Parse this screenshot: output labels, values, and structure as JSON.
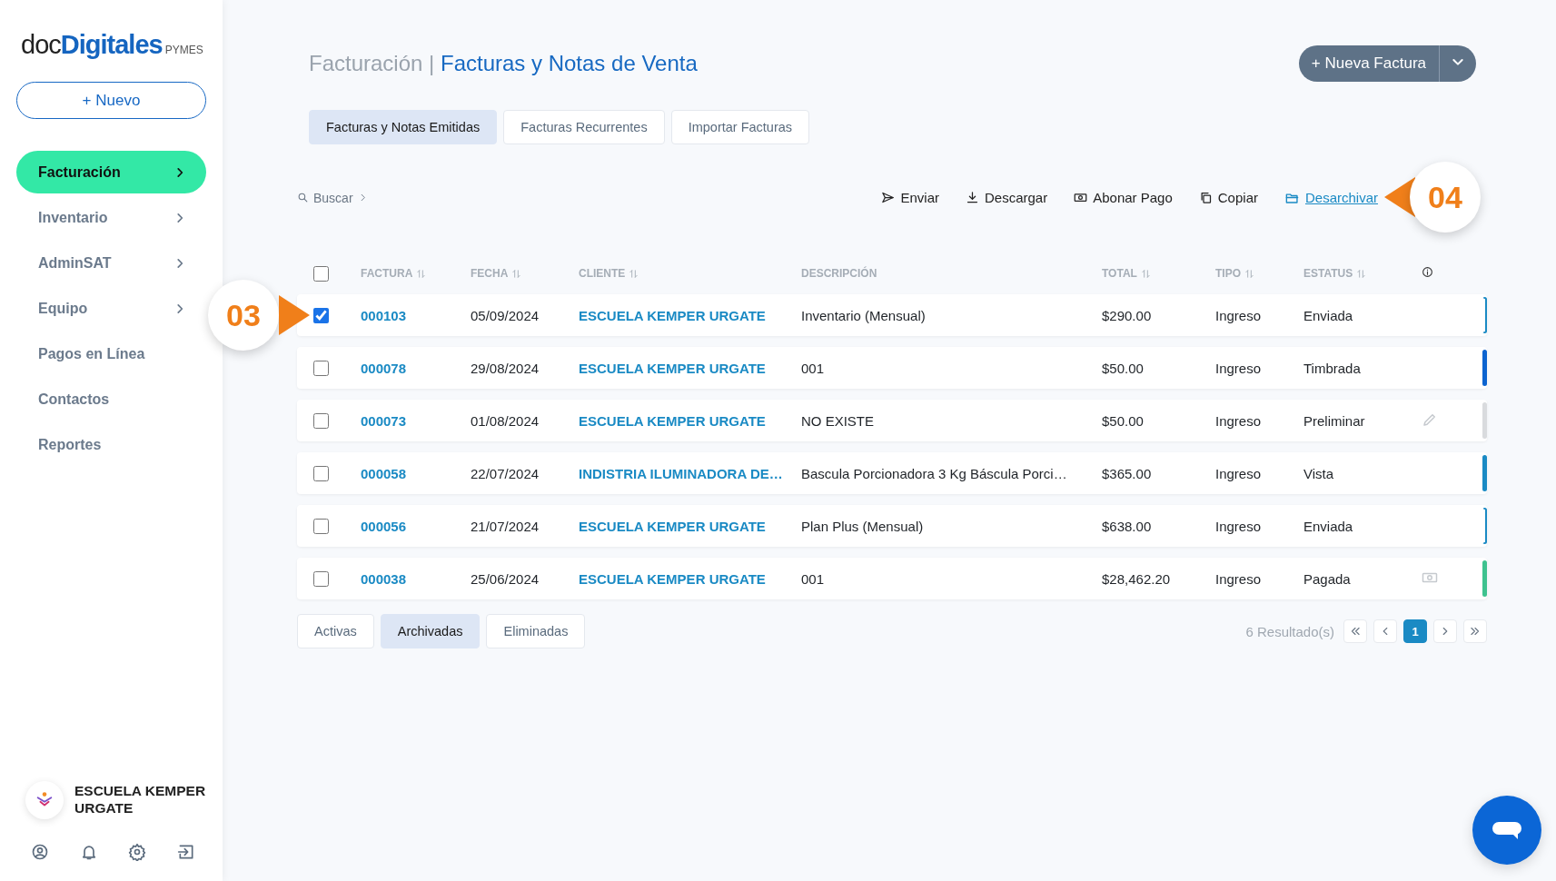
{
  "sidebar": {
    "logo": {
      "prefix": "doc",
      "brand": "Digitales",
      "suffix": "PYMES"
    },
    "new_button": {
      "icon": "+",
      "label": "Nuevo"
    },
    "items": [
      {
        "label": "Facturación",
        "selected": true,
        "has_submenu": true
      },
      {
        "label": "Inventario",
        "selected": false,
        "has_submenu": true
      },
      {
        "label": "AdminSAT",
        "selected": false,
        "has_submenu": true
      },
      {
        "label": "Equipo",
        "selected": false,
        "has_submenu": true
      },
      {
        "label": "Pagos en Línea",
        "selected": false,
        "has_submenu": false
      },
      {
        "label": "Contactos",
        "selected": false,
        "has_submenu": false
      },
      {
        "label": "Reportes",
        "selected": false,
        "has_submenu": false
      }
    ],
    "account": {
      "name": "ESCUELA KEMPER URGATE"
    },
    "footer_icons": [
      {
        "kind": "profile"
      },
      {
        "kind": "notifications"
      },
      {
        "kind": "settings"
      },
      {
        "kind": "logout"
      }
    ]
  },
  "header": {
    "breadcrumb": "Facturación",
    "separator": "|",
    "title": "Facturas y Notas de Venta",
    "primary_button": {
      "icon": "+",
      "label": "Nueva Factura"
    }
  },
  "tabs": [
    {
      "label": "Facturas y Notas Emitidas",
      "selected": true
    },
    {
      "label": "Facturas Recurrentes",
      "selected": false
    },
    {
      "label": "Importar Facturas",
      "selected": false
    }
  ],
  "toolbar": {
    "search": "Buscar",
    "actions": [
      {
        "kind": "send",
        "label": "Enviar",
        "link": false
      },
      {
        "kind": "download",
        "label": "Descargar",
        "link": false
      },
      {
        "kind": "payment",
        "label": "Abonar Pago",
        "link": false
      },
      {
        "kind": "copy",
        "label": "Copiar",
        "link": false
      },
      {
        "kind": "unarchive",
        "label": "Desarchivar",
        "link": true
      }
    ]
  },
  "table": {
    "select_all": {
      "checked": false
    },
    "columns": [
      {
        "label": "FACTURA",
        "sortable": true
      },
      {
        "label": "FECHA",
        "sortable": true
      },
      {
        "label": "CLIENTE",
        "sortable": true
      },
      {
        "label": "DESCRIPCIÓN",
        "sortable": false
      },
      {
        "label": "TOTAL",
        "sortable": true
      },
      {
        "label": "TIPO",
        "sortable": true
      },
      {
        "label": "ESTATUS",
        "sortable": true
      }
    ],
    "rows": [
      {
        "checked": true,
        "factura": "000103",
        "fecha": "05/09/2024",
        "cliente": "ESCUELA KEMPER URGATE",
        "descripcion": "Inventario (Mensual)",
        "total": "$290.00",
        "tipo": "Ingreso",
        "estatus": "Enviada",
        "status_marker": {
          "kind": "outline",
          "color": "#1a8ac4"
        }
      },
      {
        "checked": false,
        "factura": "000078",
        "fecha": "29/08/2024",
        "cliente": "ESCUELA KEMPER URGATE",
        "descripcion": "001",
        "total": "$50.00",
        "tipo": "Ingreso",
        "estatus": "Timbrada",
        "status_marker": {
          "kind": "solid",
          "color": "#0b63d0"
        }
      },
      {
        "checked": false,
        "factura": "000073",
        "fecha": "01/08/2024",
        "cliente": "ESCUELA KEMPER URGATE",
        "descripcion": "NO EXISTE",
        "total": "$50.00",
        "tipo": "Ingreso",
        "estatus": "Preliminar",
        "status_marker": {
          "kind": "solid",
          "color": "#d9dbde"
        },
        "action_icon": {
          "kind": "edit"
        }
      },
      {
        "checked": false,
        "factura": "000058",
        "fecha": "22/07/2024",
        "cliente": "INDISTRIA ILUMINADORA DE…",
        "descripcion": "Bascula Porcionadora 3 Kg Báscula Porci…",
        "total": "$365.00",
        "tipo": "Ingreso",
        "estatus": "Vista",
        "status_marker": {
          "kind": "solid",
          "color": "#1a8ac4"
        }
      },
      {
        "checked": false,
        "factura": "000056",
        "fecha": "21/07/2024",
        "cliente": "ESCUELA KEMPER URGATE",
        "descripcion": "Plan Plus (Mensual)",
        "total": "$638.00",
        "tipo": "Ingreso",
        "estatus": "Enviada",
        "status_marker": {
          "kind": "outline",
          "color": "#1a8ac4"
        }
      },
      {
        "checked": false,
        "factura": "000038",
        "fecha": "25/06/2024",
        "cliente": "ESCUELA KEMPER URGATE",
        "descripcion": "001",
        "total": "$28,462.20",
        "tipo": "Ingreso",
        "estatus": "Pagada",
        "status_marker": {
          "kind": "solid",
          "color": "#3ec28f"
        },
        "action_icon": {
          "kind": "payment"
        }
      }
    ]
  },
  "filter_tabs": [
    {
      "label": "Activas",
      "selected": false
    },
    {
      "label": "Archivadas",
      "selected": true
    },
    {
      "label": "Eliminadas",
      "selected": false
    }
  ],
  "pagination": {
    "results": "6 Resultado(s)",
    "pages": [
      {
        "label": "1",
        "selected": true
      }
    ]
  },
  "callouts": [
    {
      "label": "03",
      "kind": "right"
    },
    {
      "label": "04",
      "kind": "left"
    }
  ]
}
